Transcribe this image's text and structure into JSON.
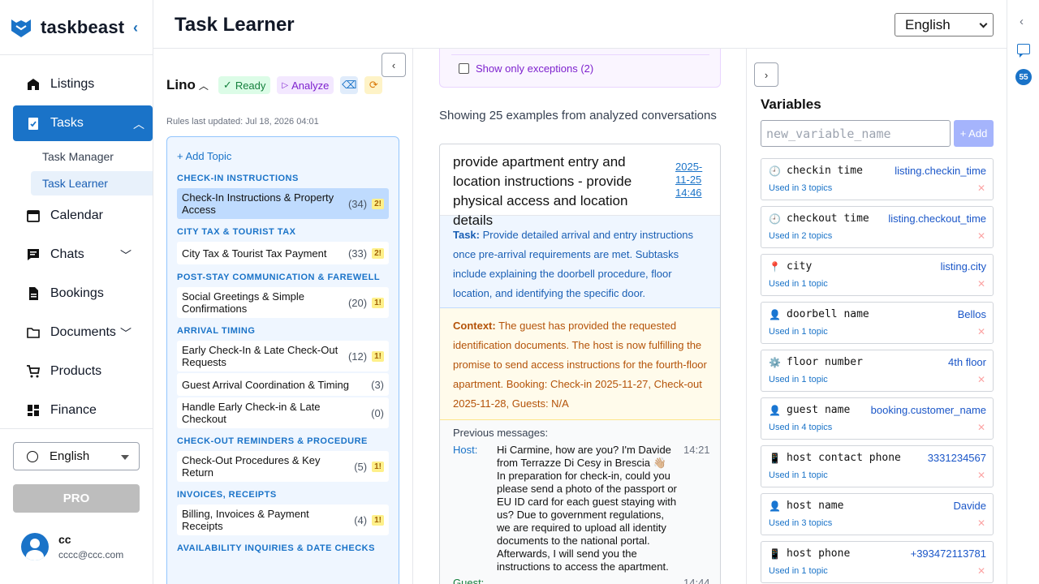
{
  "brand": {
    "name": "taskbeast"
  },
  "nav": {
    "items": [
      {
        "label": "Listings",
        "icon": "home-icon"
      },
      {
        "label": "Tasks",
        "icon": "clipboard-icon",
        "active": true
      },
      {
        "label": "Calendar",
        "icon": "calendar-icon"
      },
      {
        "label": "Chats",
        "icon": "chat-icon"
      },
      {
        "label": "Bookings",
        "icon": "document-icon"
      },
      {
        "label": "Documents",
        "icon": "folder-icon"
      },
      {
        "label": "Products",
        "icon": "cart-icon"
      },
      {
        "label": "Finance",
        "icon": "grid-icon"
      }
    ],
    "sub_items": [
      {
        "label": "Task Manager"
      },
      {
        "label": "Task Learner",
        "active": true
      }
    ]
  },
  "sidebar_bottom": {
    "language": "English",
    "pro_label": "PRO",
    "user_name": "cc",
    "user_email": "cccc@ccc.com"
  },
  "header": {
    "title": "Task Learner",
    "language": "English"
  },
  "rail": {
    "badge_count": "55"
  },
  "topics_panel": {
    "model_name": "Lino",
    "ready_label": "Ready",
    "analyze_label": "Analyze",
    "rules_updated": "Rules last updated: Jul 18, 2026 04:01",
    "add_topic": "+ Add Topic",
    "categories": [
      {
        "name": "CHECK-IN INSTRUCTIONS",
        "topics": [
          {
            "name": "Check-In Instructions & Property Access",
            "count": "(34)",
            "warn": "2!",
            "selected": true
          }
        ]
      },
      {
        "name": "CITY TAX & TOURIST TAX",
        "topics": [
          {
            "name": "City Tax & Tourist Tax Payment",
            "count": "(33)",
            "warn": "2!"
          }
        ]
      },
      {
        "name": "POST-STAY COMMUNICATION & FAREWELL",
        "topics": [
          {
            "name": "Social Greetings & Simple Confirmations",
            "count": "(20)",
            "warn": "1!"
          }
        ]
      },
      {
        "name": "ARRIVAL TIMING",
        "topics": [
          {
            "name": "Early Check-In & Late Check-Out Requests",
            "count": "(12)",
            "warn": "1!"
          },
          {
            "name": "Guest Arrival Coordination & Timing",
            "count": "(3)",
            "warn": ""
          },
          {
            "name": "Handle Early Check-in & Late Checkout",
            "count": "(0)",
            "warn": ""
          }
        ]
      },
      {
        "name": "CHECK-OUT REMINDERS & PROCEDURE",
        "topics": [
          {
            "name": "Check-Out Procedures & Key Return",
            "count": "(5)",
            "warn": "1!"
          }
        ]
      },
      {
        "name": "INVOICES, RECEIPTS",
        "topics": [
          {
            "name": "Billing, Invoices & Payment Receipts",
            "count": "(4)",
            "warn": "1!"
          }
        ]
      },
      {
        "name": "AVAILABILITY INQUIRIES & DATE CHECKS",
        "topics": []
      }
    ]
  },
  "examples_panel": {
    "exceptions_label": "Show only exceptions (2)",
    "showing_text": "Showing 25 examples from analyzed conversations",
    "example": {
      "title": "provide apartment entry and location instructions - provide physical access and location details",
      "date": "2025-11-25 14:46",
      "task_label": "Task:",
      "task_text": "Provide detailed arrival and entry instructions once pre-arrival requirements are met. Subtasks include explaining the doorbell procedure, floor location, and identifying the specific door.",
      "context_label": "Context:",
      "context_text": "The guest has provided the requested identification documents. The host is now fulfilling the promise to send access instructions for the fourth-floor apartment. Booking: Check-in 2025-11-27, Check-out 2025-11-28, Guests: N/A",
      "previous_label": "Previous messages:",
      "messages": [
        {
          "who": "Host:",
          "text": "Hi Carmine, how are you? I'm Davide from Terrazze Di Cesy in Brescia 👋🏼 In preparation for check-in, could you please send a photo of the passport or EU ID card for each guest staying with us? Due to government regulations, we are required to upload all identity documents to the national portal. Afterwards, I will send you the instructions to access the apartment.",
          "time": "14:21"
        },
        {
          "who": "Guest:",
          "text": "",
          "time": "14:44"
        }
      ]
    }
  },
  "variables_panel": {
    "title": "Variables",
    "new_placeholder": "new_variable_name",
    "add_label": "+ Add",
    "items": [
      {
        "icon": "clock-icon",
        "glyph": "🕘",
        "name": "checkin time",
        "value": "listing.checkin_time",
        "used": "Used in 3 topics"
      },
      {
        "icon": "clock-icon",
        "glyph": "🕘",
        "name": "checkout time",
        "value": "listing.checkout_time",
        "used": "Used in 2 topics"
      },
      {
        "icon": "pin-icon",
        "glyph": "📍",
        "name": "city",
        "value": "listing.city",
        "used": "Used in 1 topic"
      },
      {
        "icon": "person-icon",
        "glyph": "👤",
        "name": "doorbell name",
        "value": "Bellos",
        "used": "Used in 1 topic"
      },
      {
        "icon": "gear-icon",
        "glyph": "⚙️",
        "name": "floor number",
        "value": "4th floor",
        "used": "Used in 1 topic"
      },
      {
        "icon": "person-icon",
        "glyph": "👤",
        "name": "guest name",
        "value": "booking.customer_name",
        "used": "Used in 4 topics"
      },
      {
        "icon": "phone-icon",
        "glyph": "📱",
        "name": "host contact phone",
        "value": "3331234567",
        "used": "Used in 1 topic"
      },
      {
        "icon": "person-icon",
        "glyph": "👤",
        "name": "host name",
        "value": "Davide",
        "used": "Used in 3 topics"
      },
      {
        "icon": "phone-icon",
        "glyph": "📱",
        "name": "host phone",
        "value": "+393472113781",
        "used": "Used in 1 topic"
      }
    ]
  },
  "colors": {
    "primary": "#1a73c8",
    "purple": "#7e22ce",
    "warn": "#fef08a"
  }
}
